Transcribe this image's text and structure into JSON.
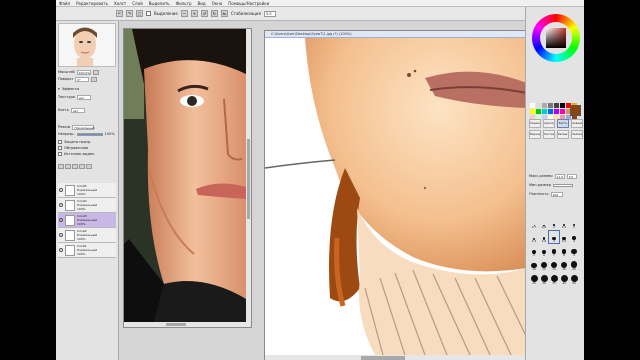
{
  "menu": [
    "Файл",
    "Редактировать",
    "Холст",
    "Слой",
    "Выделить",
    "Фильтр",
    "Вид",
    "Окно",
    "Помощь/Настройки"
  ],
  "toolbar": {
    "selection_label": "Выделение",
    "smooth_label": "Стабилизация",
    "smooth_value": "S-5"
  },
  "left_panel": {
    "zoom_label": "Масштаб",
    "zoom_value": "100.0%",
    "rotate_label": "Поворот",
    "rotate_value": "0°",
    "effects_label": "Эффекты",
    "texture_label": "Текстура",
    "texture_value": "нет",
    "brush_label": "Кисть",
    "brush_value": "нет",
    "blend_label": "Режим",
    "blend_value": "Нормальный",
    "opacity_label": "Непрозр.",
    "opacity_value": "100%",
    "opacity_fill": 1.0,
    "protect_label": "Защита прозр.",
    "clip_label": "Обтравочная",
    "source_label": "Источник выдел.",
    "layers": [
      {
        "name": "Слой5",
        "mode": "Нормальный",
        "opacity": "100%",
        "selected": false
      },
      {
        "name": "Слой4",
        "mode": "Нормальный",
        "opacity": "100%",
        "selected": false
      },
      {
        "name": "Слой3",
        "mode": "Нормальный",
        "opacity": "100%",
        "selected": true
      },
      {
        "name": "Слой2",
        "mode": "Нормальный",
        "opacity": "100%",
        "selected": false
      },
      {
        "name": "Слой1",
        "mode": "Нормальный",
        "opacity": "100%",
        "selected": false
      }
    ]
  },
  "main_window": {
    "title": "C:\\Users\\User\\Desktop\\ЗуевТ\\1.jpg (*) (100%)"
  },
  "right_panel": {
    "current_color": "#8b4513",
    "tools": [
      "Карандаш",
      "Аэрограф",
      "Кисть",
      "Акварель",
      "Маркер",
      "Ластик",
      "Размыт.",
      "Заливка"
    ],
    "active_tool_index": 2,
    "max_size_label": "Макс.размер",
    "min_size_label": "Мин.размер",
    "density_label": "Плотность",
    "max_size_value": "x1.0",
    "size_value": "3.0",
    "density_value": "100",
    "sizes": [
      "0.7",
      "0.8",
      "1",
      "1.5",
      "2",
      "2.3",
      "2.6",
      "3",
      "3.5",
      "4",
      "5",
      "6",
      "7",
      "8",
      "9",
      "10",
      "12",
      "14",
      "16",
      "20",
      "25",
      "30",
      "35",
      "40",
      "50"
    ],
    "selected_size_index": 7
  }
}
